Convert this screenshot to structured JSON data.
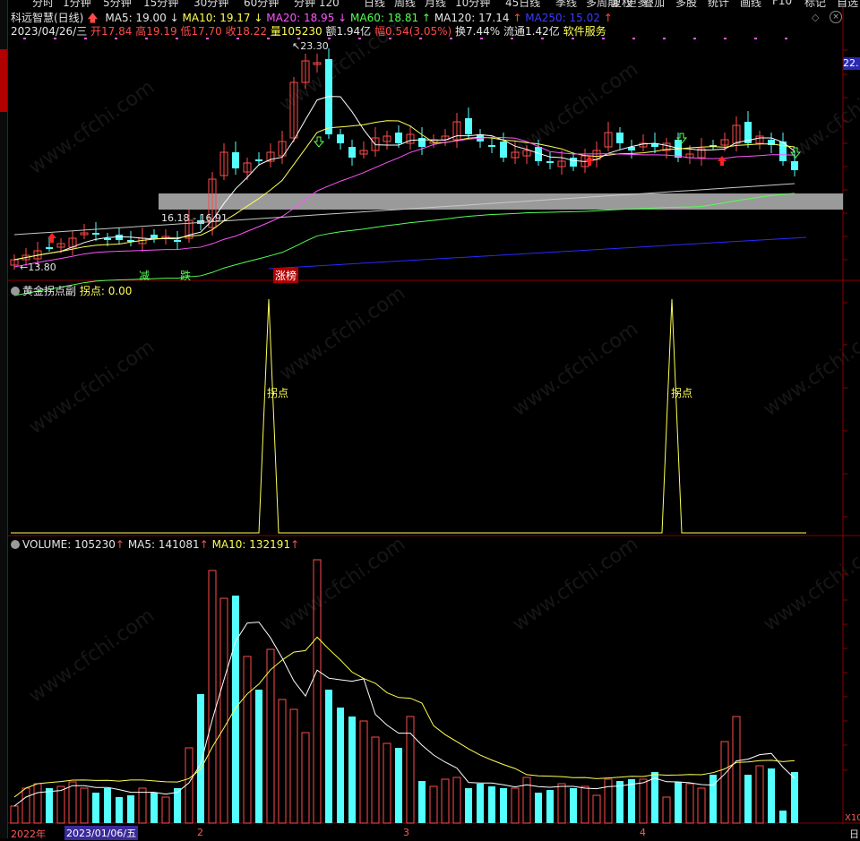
{
  "toolbar": {
    "left_items": [
      "分时",
      "1分钟",
      "5分钟",
      "15分钟",
      "30分钟",
      "60分钟",
      "分钟 120",
      "日线",
      "周线",
      "月线",
      "10分钟",
      "45日线",
      "季线",
      "多周期",
      "更多"
    ],
    "right_items": [
      "复权",
      "叠加",
      "多股",
      "统计",
      "画线",
      "F10",
      "标记",
      "自选"
    ]
  },
  "header": {
    "stock_name": "科远智慧(日线)",
    "ma5": "MA5: 19.00",
    "ma10": "MA10: 19.17",
    "ma20": "MA20: 18.95",
    "ma60": "MA60: 18.81",
    "ma120": "MA120: 17.14",
    "ma250": "MA250: 15.02",
    "date": "2023/04/26/三",
    "open": "开17.84",
    "high": "高19.19",
    "low": "低17.70",
    "close": "收18.22",
    "volume": "量105230",
    "amount": "额1.94亿",
    "change": "幅0.54(3.05%)",
    "turnover": "换7.44%",
    "float": "流通1.42亿",
    "sector": "软件服务",
    "price_tag": "22."
  },
  "annotations": {
    "high_mark": "23.30",
    "low_mark": "13.80",
    "band_label": "16.18 - 16.91",
    "sig1": "减",
    "sig2": "跌",
    "sig3": "涨榜"
  },
  "indicator": {
    "title": "黄金拐点副",
    "value": "拐点: 0.00",
    "peak_label_1": "拐点",
    "peak_label_2": "拐点",
    "peaks_at_bar": [
      24,
      62
    ]
  },
  "volume_panel": {
    "title": "VOLUME: 105230",
    "ma5": "MA5: 141081",
    "ma10": "MA10: 132191",
    "unit": "X10"
  },
  "time_axis": {
    "year": "2022年",
    "cursor_date": "2023/01/06/五",
    "months": [
      "2",
      "3",
      "4"
    ],
    "right_label": "日"
  },
  "watermark": "www.cfchi.com",
  "colors": {
    "up": "#ff4b4b",
    "down": "#54ffff",
    "ma5": "#ffffff",
    "ma10": "#ffff54",
    "ma20": "#ff54ff",
    "ma60": "#54ff54",
    "ma120": "#c8c8c8",
    "ma250": "#2a2aff",
    "band": "#9a9a9a",
    "border": "#8b0000"
  }
}
